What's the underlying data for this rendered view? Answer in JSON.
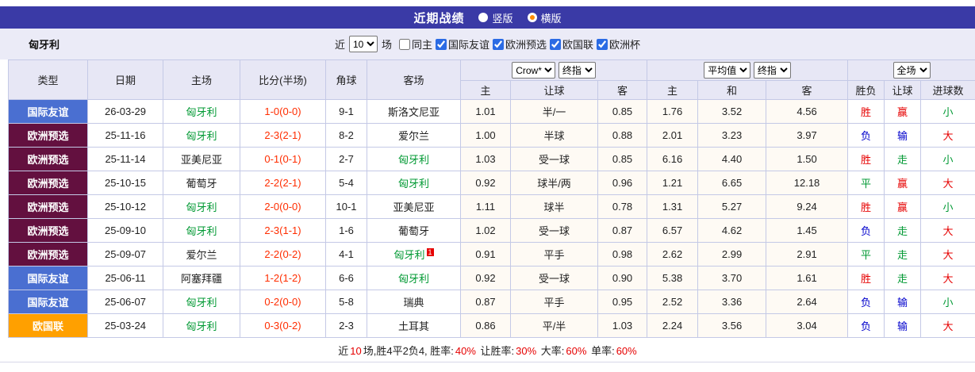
{
  "colors": {
    "titlebar_bg": "#3a3aa6",
    "panel_bg": "#ebebf7",
    "badge_friendly": "#4a6fd1",
    "badge_qualifier": "#63103f",
    "badge_nations": "#ffa000",
    "team_green": "#009933",
    "score_red": "#ff2d00",
    "win_red": "#e60000",
    "lose_blue": "#0000cc",
    "draw_green": "#009933"
  },
  "title_bar": {
    "title": "近期战绩",
    "view_options": [
      {
        "label": "竖版",
        "selected": false
      },
      {
        "label": "横版",
        "selected": true
      }
    ]
  },
  "filter_bar": {
    "team": "匈牙利",
    "near_label": "近",
    "count": "10",
    "games_label": "场",
    "checks": [
      {
        "label": "同主",
        "checked": false
      },
      {
        "label": "国际友谊",
        "checked": true
      },
      {
        "label": "欧洲预选",
        "checked": true
      },
      {
        "label": "欧国联",
        "checked": true
      },
      {
        "label": "欧洲杯",
        "checked": true
      }
    ]
  },
  "table": {
    "headers": {
      "type": "类型",
      "date": "日期",
      "home": "主场",
      "score": "比分(半场)",
      "corner": "角球",
      "away": "客场"
    },
    "selects": {
      "bookmaker": "Crow*",
      "asian_final": "终指",
      "average": "平均值",
      "euro_final": "终指",
      "full_match": "全场"
    },
    "sub_headers": [
      "主",
      "让球",
      "客",
      "主",
      "和",
      "客",
      "胜负",
      "让球",
      "进球数"
    ],
    "rows": [
      {
        "type": "国际友谊",
        "style": "friendly",
        "date": "26-03-29",
        "home": {
          "name": "匈牙利",
          "green": true
        },
        "score": "1-0(0-0)",
        "corner": "9-1",
        "away": {
          "name": "斯洛文尼亚",
          "green": false
        },
        "asian": [
          "1.01",
          "半/一",
          "0.85"
        ],
        "euro": [
          "1.76",
          "3.52",
          "4.56"
        ],
        "result": [
          {
            "t": "胜",
            "c": "red"
          },
          {
            "t": "赢",
            "c": "red"
          },
          {
            "t": "小",
            "c": "green"
          }
        ]
      },
      {
        "type": "欧洲预选",
        "style": "qualifier",
        "date": "25-11-16",
        "home": {
          "name": "匈牙利",
          "green": true
        },
        "score": "2-3(2-1)",
        "corner": "8-2",
        "away": {
          "name": "爱尔兰",
          "green": false
        },
        "asian": [
          "1.00",
          "半球",
          "0.88"
        ],
        "euro": [
          "2.01",
          "3.23",
          "3.97"
        ],
        "result": [
          {
            "t": "负",
            "c": "blue"
          },
          {
            "t": "输",
            "c": "blue"
          },
          {
            "t": "大",
            "c": "red"
          }
        ]
      },
      {
        "type": "欧洲预选",
        "style": "qualifier",
        "date": "25-11-14",
        "home": {
          "name": "亚美尼亚",
          "green": false
        },
        "score": "0-1(0-1)",
        "corner": "2-7",
        "away": {
          "name": "匈牙利",
          "green": true
        },
        "asian": [
          "1.03",
          "受一球",
          "0.85"
        ],
        "euro": [
          "6.16",
          "4.40",
          "1.50"
        ],
        "result": [
          {
            "t": "胜",
            "c": "red"
          },
          {
            "t": "走",
            "c": "green"
          },
          {
            "t": "小",
            "c": "green"
          }
        ]
      },
      {
        "type": "欧洲预选",
        "style": "qualifier",
        "date": "25-10-15",
        "home": {
          "name": "葡萄牙",
          "green": false
        },
        "score": "2-2(2-1)",
        "corner": "5-4",
        "away": {
          "name": "匈牙利",
          "green": true
        },
        "asian": [
          "0.92",
          "球半/两",
          "0.96"
        ],
        "euro": [
          "1.21",
          "6.65",
          "12.18"
        ],
        "result": [
          {
            "t": "平",
            "c": "green"
          },
          {
            "t": "赢",
            "c": "red"
          },
          {
            "t": "大",
            "c": "red"
          }
        ]
      },
      {
        "type": "欧洲预选",
        "style": "qualifier",
        "date": "25-10-12",
        "home": {
          "name": "匈牙利",
          "green": true
        },
        "score": "2-0(0-0)",
        "corner": "10-1",
        "away": {
          "name": "亚美尼亚",
          "green": false
        },
        "asian": [
          "1.11",
          "球半",
          "0.78"
        ],
        "euro": [
          "1.31",
          "5.27",
          "9.24"
        ],
        "result": [
          {
            "t": "胜",
            "c": "red"
          },
          {
            "t": "赢",
            "c": "red"
          },
          {
            "t": "小",
            "c": "green"
          }
        ]
      },
      {
        "type": "欧洲预选",
        "style": "qualifier",
        "date": "25-09-10",
        "home": {
          "name": "匈牙利",
          "green": true
        },
        "score": "2-3(1-1)",
        "corner": "1-6",
        "away": {
          "name": "葡萄牙",
          "green": false
        },
        "asian": [
          "1.02",
          "受一球",
          "0.87"
        ],
        "euro": [
          "6.57",
          "4.62",
          "1.45"
        ],
        "result": [
          {
            "t": "负",
            "c": "blue"
          },
          {
            "t": "走",
            "c": "green"
          },
          {
            "t": "大",
            "c": "red"
          }
        ]
      },
      {
        "type": "欧洲预选",
        "style": "qualifier",
        "date": "25-09-07",
        "home": {
          "name": "爱尔兰",
          "green": false
        },
        "score": "2-2(0-2)",
        "corner": "4-1",
        "away": {
          "name": "匈牙利",
          "green": true,
          "note": "1"
        },
        "asian": [
          "0.91",
          "平手",
          "0.98"
        ],
        "euro": [
          "2.62",
          "2.99",
          "2.91"
        ],
        "result": [
          {
            "t": "平",
            "c": "green"
          },
          {
            "t": "走",
            "c": "green"
          },
          {
            "t": "大",
            "c": "red"
          }
        ]
      },
      {
        "type": "国际友谊",
        "style": "friendly",
        "date": "25-06-11",
        "home": {
          "name": "阿塞拜疆",
          "green": false
        },
        "score": "1-2(1-2)",
        "corner": "6-6",
        "away": {
          "name": "匈牙利",
          "green": true
        },
        "asian": [
          "0.92",
          "受一球",
          "0.90"
        ],
        "euro": [
          "5.38",
          "3.70",
          "1.61"
        ],
        "result": [
          {
            "t": "胜",
            "c": "red"
          },
          {
            "t": "走",
            "c": "green"
          },
          {
            "t": "大",
            "c": "red"
          }
        ]
      },
      {
        "type": "国际友谊",
        "style": "friendly",
        "date": "25-06-07",
        "home": {
          "name": "匈牙利",
          "green": true
        },
        "score": "0-2(0-0)",
        "corner": "5-8",
        "away": {
          "name": "瑞典",
          "green": false
        },
        "asian": [
          "0.87",
          "平手",
          "0.95"
        ],
        "euro": [
          "2.52",
          "3.36",
          "2.64"
        ],
        "result": [
          {
            "t": "负",
            "c": "blue"
          },
          {
            "t": "输",
            "c": "blue"
          },
          {
            "t": "小",
            "c": "green"
          }
        ]
      },
      {
        "type": "欧国联",
        "style": "nations",
        "date": "25-03-24",
        "home": {
          "name": "匈牙利",
          "green": true
        },
        "score": "0-3(0-2)",
        "corner": "2-3",
        "away": {
          "name": "土耳其",
          "green": false
        },
        "asian": [
          "0.86",
          "平/半",
          "1.03"
        ],
        "euro": [
          "2.24",
          "3.56",
          "3.04"
        ],
        "result": [
          {
            "t": "负",
            "c": "blue"
          },
          {
            "t": "输",
            "c": "blue"
          },
          {
            "t": "大",
            "c": "red"
          }
        ]
      }
    ]
  },
  "footer": {
    "segments": [
      {
        "t": "近",
        "c": "black"
      },
      {
        "t": "10",
        "c": "red"
      },
      {
        "t": "场,胜4平2负4, 胜率:",
        "c": "black"
      },
      {
        "t": "40%",
        "c": "red"
      },
      {
        "t": " 让胜率:",
        "c": "black"
      },
      {
        "t": "30%",
        "c": "red"
      },
      {
        "t": " 大率:",
        "c": "black"
      },
      {
        "t": "60%",
        "c": "red"
      },
      {
        "t": " 单率:",
        "c": "black"
      },
      {
        "t": "60%",
        "c": "red"
      }
    ]
  }
}
